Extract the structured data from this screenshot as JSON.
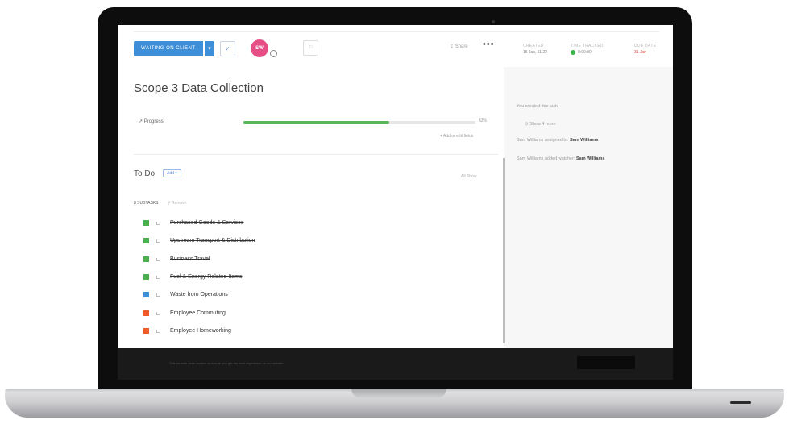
{
  "toolbar": {
    "status_label": "WAITING ON CLIENT",
    "caret": "▾",
    "check": "✓",
    "avatar_initials": "SW",
    "tag": "⚐",
    "share": "⇪ Share",
    "more": "•••"
  },
  "meta": {
    "created_label": "CREATED",
    "created_value": "15 Jan, 11:22",
    "time_tracked_label": "TIME TRACKED",
    "time_tracked_value": "0:00:00",
    "due_label": "DUE DATE",
    "due_value": "31 Jan"
  },
  "task": {
    "title": "Scope 3 Data Collection",
    "progress_label": "↗ Progress",
    "progress_percent": 63,
    "progress_text": "63%",
    "add_field": "+ Add or edit fields"
  },
  "todo": {
    "label": "To Do",
    "add_label": "Add ▾",
    "list_tools": "All   Show",
    "subtasks_count": "8 SUBTASKS",
    "remove_label": "⚲ Remove",
    "items": [
      {
        "name": "Purchased Goods & Services",
        "color": "#4caf50",
        "done": true
      },
      {
        "name": "Upstream Transport & Distribution",
        "color": "#4caf50",
        "done": true
      },
      {
        "name": "Business Travel",
        "color": "#4caf50",
        "done": true
      },
      {
        "name": "Fuel & Energy Related Items",
        "color": "#4caf50",
        "done": true
      },
      {
        "name": "Waste from Operations",
        "color": "#3e8ed8",
        "done": false
      },
      {
        "name": "Employee Commuting",
        "color": "#f05a28",
        "done": false
      },
      {
        "name": "Employee Homeworking",
        "color": "#f05a28",
        "done": false
      }
    ]
  },
  "activity": {
    "line1": "You created this task",
    "line2": "⊙ Show 4 more",
    "line3_prefix": "Sam Williams assigned to:",
    "line3_name": "Sam Williams",
    "line4_prefix": "Sam Williams added watcher:",
    "line4_name": "Sam Williams"
  },
  "footer": {
    "text": "This website uses cookies to ensure you get the best experience on our website"
  },
  "colors": {
    "accent": "#3e8ed8",
    "avatar": "#e64f86",
    "progress": "#5bb55a",
    "due": "#e84c3d"
  }
}
